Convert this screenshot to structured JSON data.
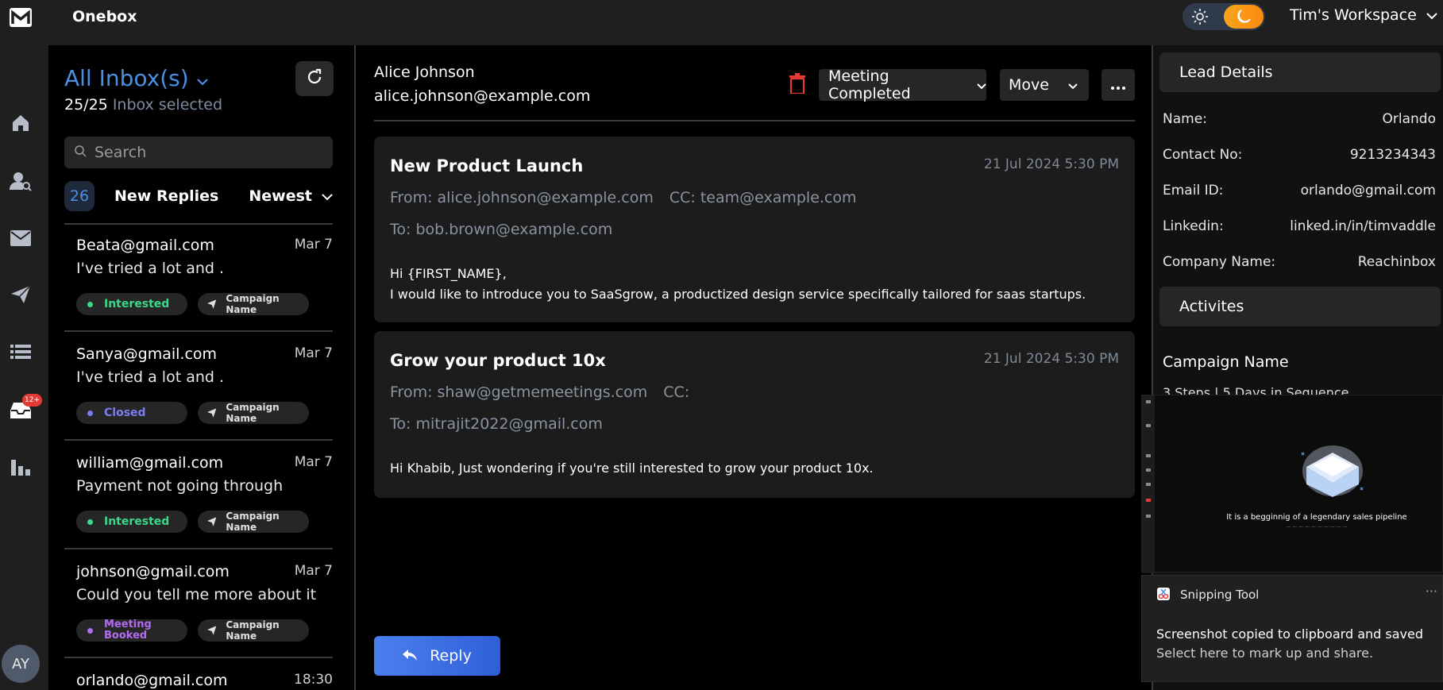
{
  "app": {
    "brand": "Onebox",
    "workspace": "Tim's Workspace",
    "avatar_initials": "AY",
    "inbox_badge": "12+"
  },
  "colors": {
    "accent": "#4a90e2",
    "interested": "#38d98a",
    "closed": "#7b7cf0",
    "meeting_booked": "#b36cf0",
    "danger": "#e53935",
    "toggle": "#f7a51b"
  },
  "inbox": {
    "title": "All Inbox(s)",
    "selected_count": "25/25",
    "selected_label": "Inbox selected",
    "search_placeholder": "Search",
    "new_count": "26",
    "new_label": "New Replies",
    "sort_label": "Newest",
    "threads": [
      {
        "email": "Beata@gmail.com",
        "date": "Mar 7",
        "preview": "I've tried a lot and .",
        "status": "Interested",
        "campaign": "Campaign Name"
      },
      {
        "email": "Sanya@gmail.com",
        "date": "Mar 7",
        "preview": "I've tried a lot and .",
        "status": "Closed",
        "campaign": "Campaign Name"
      },
      {
        "email": "william@gmail.com",
        "date": "Mar 7",
        "preview": "Payment not going through",
        "status": "Interested",
        "campaign": "Campaign Name"
      },
      {
        "email": "johnson@gmail.com",
        "date": "Mar 7",
        "preview": "Could you tell me more about it",
        "status": "Meeting Booked",
        "campaign": "Campaign Name"
      },
      {
        "email": "orlando@gmail.com",
        "date": "18:30"
      }
    ]
  },
  "thread": {
    "sender_name": "Alice Johnson",
    "sender_email": "alice.johnson@example.com",
    "status_select": "Meeting Completed",
    "move_select": "Move",
    "messages": [
      {
        "subject": "New Product Launch",
        "timestamp": "21 Jul 2024 5:30 PM",
        "from": "From: alice.johnson@example.com",
        "cc": "CC: team@example.com",
        "to": "To: bob.brown@example.com",
        "body_line1": "Hi {FIRST_NAME},",
        "body_line2": "I would like to introduce you to SaaSgrow, a productized design service specifically tailored for saas startups."
      },
      {
        "subject": "Grow your product 10x",
        "timestamp": "21 Jul 2024 5:30 PM",
        "from": "From: shaw@getmemeetings.com",
        "cc": "CC:",
        "to": "To: mitrajit2022@gmail.com",
        "body_line1": "Hi Khabib, Just wondering if you're still interested to grow your product 10x."
      }
    ],
    "reply_label": "Reply"
  },
  "lead": {
    "title": "Lead Details",
    "fields": [
      {
        "label": "Name:",
        "value": "Orlando"
      },
      {
        "label": "Contact No:",
        "value": "9213234343"
      },
      {
        "label": "Email ID:",
        "value": "orlando@gmail.com"
      },
      {
        "label": "Linkedin:",
        "value": "linked.in/in/timvaddle"
      },
      {
        "label": "Company Name:",
        "value": "Reachinbox"
      }
    ],
    "activities_title": "Activites",
    "campaign_name": "Campaign Name",
    "campaign_steps": "3 Steps | 5 Days in Sequence"
  },
  "snip": {
    "preview_text": "It is a begginnig of a legendary sales pipeline",
    "app_name": "Snipping Tool",
    "line1": "Screenshot copied to clipboard and saved",
    "line2": "Select here to mark up and share."
  }
}
